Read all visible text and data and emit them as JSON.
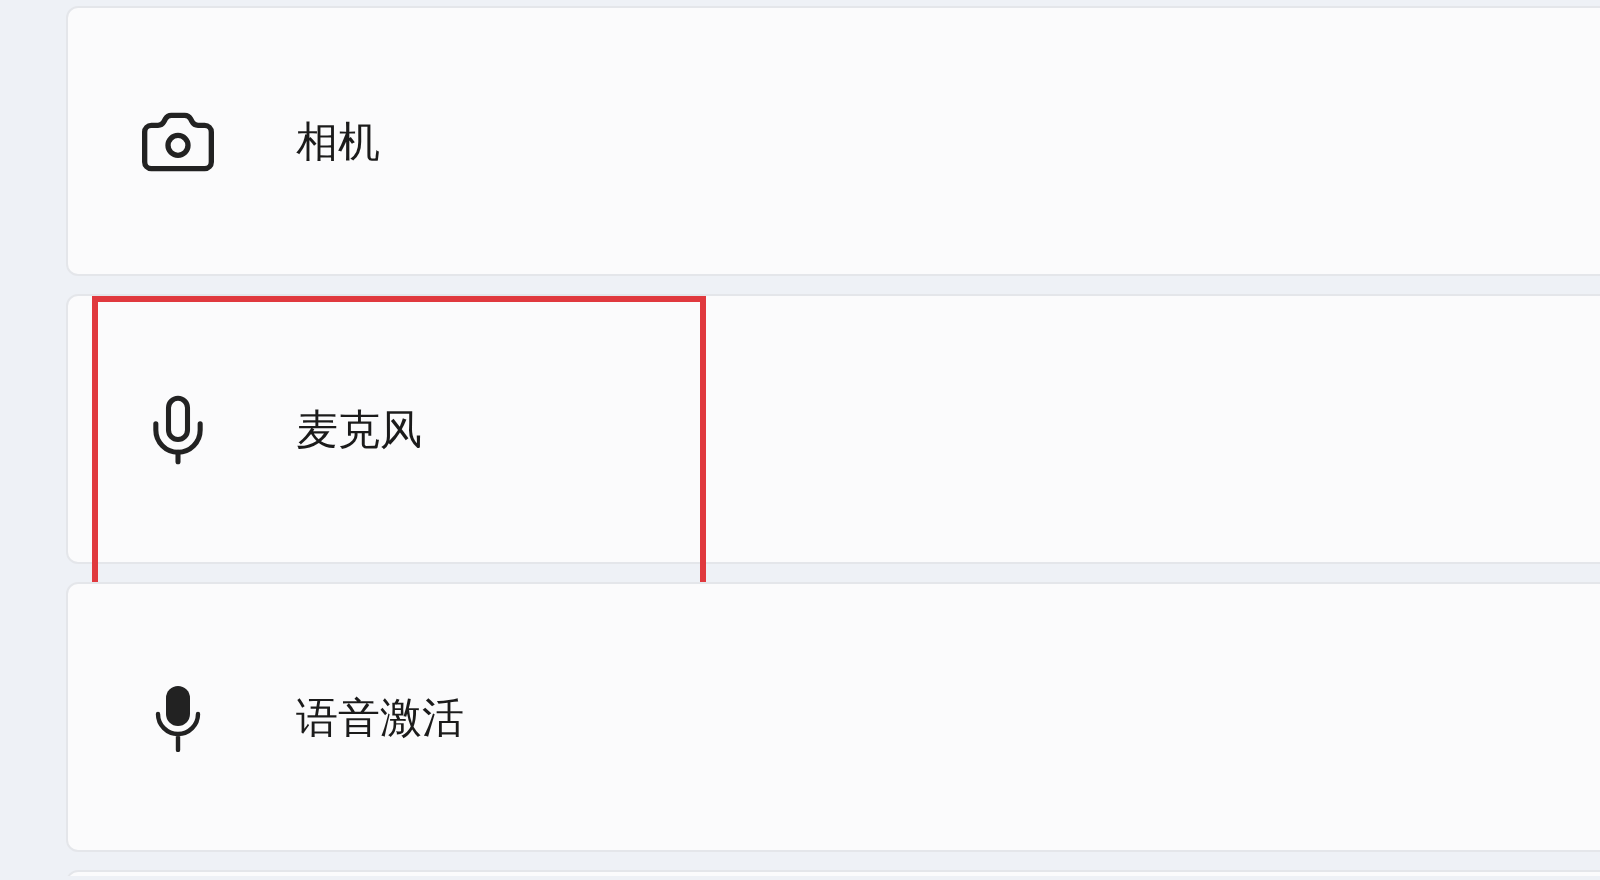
{
  "settings_items": [
    {
      "kind": "camera",
      "label": "相机",
      "highlighted": false
    },
    {
      "kind": "microphone",
      "label": "麦克风",
      "highlighted": true
    },
    {
      "kind": "voice",
      "label": "语音激活",
      "highlighted": false
    }
  ]
}
